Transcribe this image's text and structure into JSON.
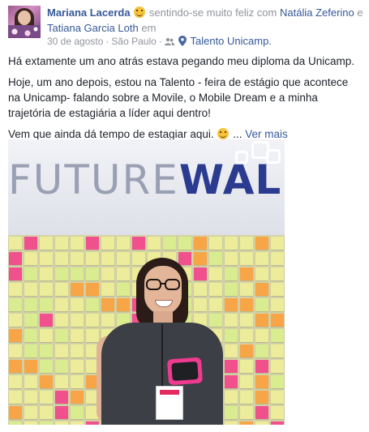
{
  "post": {
    "author": "Mariana Lacerda",
    "feeling": "sentindo-se muito feliz com",
    "tagged_1": "Natália Zeferino",
    "conjunction": "e",
    "tagged_2": "Tatiana Garcia Loth",
    "location_prefix": "em",
    "location": "Talento Unicamp.",
    "date": "30 de agosto",
    "separator": "·",
    "city": "São Paulo",
    "privacy_icon": "friends-icon",
    "place_icon": "map-pin-icon",
    "feeling_icon": "smiling-face-icon"
  },
  "body": {
    "p1": "Há extamente um ano atrás estava pegando meu diploma da Unicamp.",
    "p2": "Hoje, um ano depois, estou na Talento - feira de estágio que acontece na Unicamp- falando sobre a Movile, o Mobile Dream e a minha trajetória de estagiária a líder aqui dentro!",
    "p3": "Vem que ainda dá tempo de estagiar aqui.",
    "ellipsis": "...",
    "see_more": "Ver mais"
  },
  "photo": {
    "wall_light": "FUTURE",
    "wall_bold": "WALL"
  },
  "colors": {
    "link": "#365899",
    "muted": "#90949c",
    "text": "#1d2129",
    "wall_bold": "#2b3b8f",
    "note_pink": "#f0508c",
    "note_orange": "#f7a547",
    "note_yellow": "#ecec9a",
    "note_green": "#d9ec8f"
  }
}
